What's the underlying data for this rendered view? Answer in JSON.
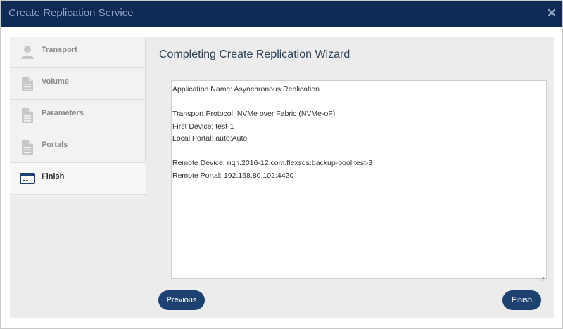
{
  "dialog": {
    "title": "Create Replication Service"
  },
  "sidebar": {
    "items": [
      {
        "label": "Transport",
        "icon": "user-icon",
        "active": false
      },
      {
        "label": "Volume",
        "icon": "document-icon",
        "active": false
      },
      {
        "label": "Parameters",
        "icon": "document-icon",
        "active": false
      },
      {
        "label": "Portals",
        "icon": "document-icon",
        "active": false
      },
      {
        "label": "Finish",
        "icon": "credit-card-icon",
        "active": true
      }
    ]
  },
  "main": {
    "heading": "Completing Create Replication Wizard",
    "summary_lines": [
      "Application Name: Asynchronous Replication",
      "",
      "Transport Protocol: NVMe over Fabric (NVMe-oF)",
      "First Device: test-1",
      "Local Portal: auto:Auto",
      "",
      "Remote Device: nqn.2016-12.com.flexsds:backup-pool.test-3",
      "Remote Portal: 192.168.80.102:4420"
    ]
  },
  "buttons": {
    "previous": "Previous",
    "finish": "Finish"
  },
  "colors": {
    "titlebar": "#0e2a55",
    "title_text": "#8fa7c6",
    "button": "#1d4170",
    "heading": "#2a3f54"
  }
}
